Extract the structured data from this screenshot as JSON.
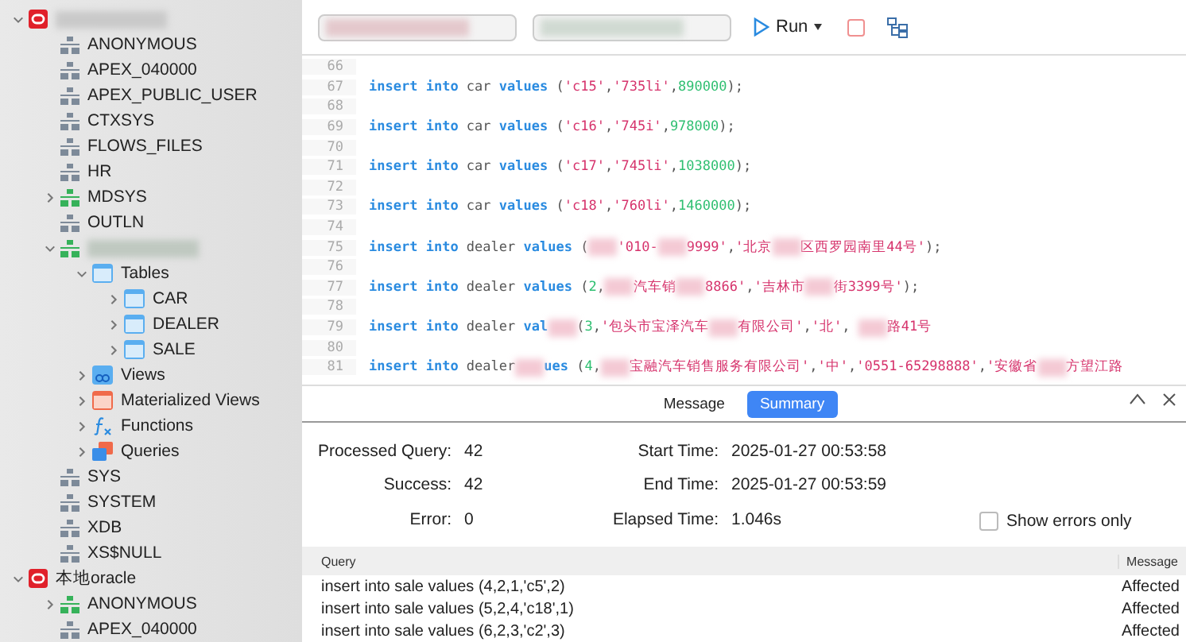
{
  "sidebar": {
    "tree": [
      {
        "kind": "connection",
        "redacted": true,
        "expanded": true,
        "children": [
          {
            "kind": "schema",
            "label": "ANONYMOUS",
            "open": false
          },
          {
            "kind": "schema",
            "label": "APEX_040000",
            "open": false
          },
          {
            "kind": "schema",
            "label": "APEX_PUBLIC_USER",
            "open": false
          },
          {
            "kind": "schema",
            "label": "CTXSYS",
            "open": false
          },
          {
            "kind": "schema",
            "label": "FLOWS_FILES",
            "open": false
          },
          {
            "kind": "schema",
            "label": "HR",
            "open": false
          },
          {
            "kind": "schema",
            "label": "MDSYS",
            "open": true,
            "expanded": false
          },
          {
            "kind": "schema",
            "label": "OUTLN",
            "open": false
          },
          {
            "kind": "schema",
            "redacted": true,
            "open": true,
            "expanded": true,
            "children": [
              {
                "kind": "tables",
                "label": "Tables",
                "expanded": true,
                "children": [
                  {
                    "kind": "table",
                    "label": "CAR",
                    "expanded": false
                  },
                  {
                    "kind": "table",
                    "label": "DEALER",
                    "expanded": false
                  },
                  {
                    "kind": "table",
                    "label": "SALE",
                    "expanded": false
                  }
                ]
              },
              {
                "kind": "views",
                "label": "Views",
                "expanded": false
              },
              {
                "kind": "matviews",
                "label": "Materialized Views",
                "expanded": false
              },
              {
                "kind": "functions",
                "label": "Functions",
                "expanded": false
              },
              {
                "kind": "queries",
                "label": "Queries",
                "expanded": false
              }
            ]
          },
          {
            "kind": "schema",
            "label": "SYS",
            "open": false
          },
          {
            "kind": "schema",
            "label": "SYSTEM",
            "open": false
          },
          {
            "kind": "schema",
            "label": "XDB",
            "open": false
          },
          {
            "kind": "schema",
            "label": "XS$NULL",
            "open": false
          }
        ]
      },
      {
        "kind": "connection",
        "label": "本地oracle",
        "expanded": true,
        "children": [
          {
            "kind": "schema",
            "label": "ANONYMOUS",
            "open": true,
            "expanded": false
          },
          {
            "kind": "schema",
            "label": "APEX_040000",
            "open": false
          }
        ]
      }
    ]
  },
  "toolbar": {
    "run_label": "Run"
  },
  "editor": {
    "lines": [
      {
        "number": "66"
      },
      {
        "number": "67",
        "tokens": [
          {
            "kind": "kw",
            "text": "insert"
          },
          {
            "kind": "kw",
            "text": " into"
          },
          {
            "kind": "id",
            "text": " car "
          },
          {
            "kind": "kw",
            "text": "values"
          },
          {
            "kind": "id",
            "text": " ("
          },
          {
            "kind": "str",
            "text": "'c15'"
          },
          {
            "kind": "id",
            "text": ","
          },
          {
            "kind": "str",
            "text": "'735li'"
          },
          {
            "kind": "id",
            "text": ","
          },
          {
            "kind": "num",
            "text": "890000"
          },
          {
            "kind": "id",
            "text": ");"
          }
        ]
      },
      {
        "number": "68"
      },
      {
        "number": "69",
        "tokens": [
          {
            "kind": "kw",
            "text": "insert"
          },
          {
            "kind": "kw",
            "text": " into"
          },
          {
            "kind": "id",
            "text": " car "
          },
          {
            "kind": "kw",
            "text": "values"
          },
          {
            "kind": "id",
            "text": " ("
          },
          {
            "kind": "str",
            "text": "'c16'"
          },
          {
            "kind": "id",
            "text": ","
          },
          {
            "kind": "str",
            "text": "'745i'"
          },
          {
            "kind": "id",
            "text": ","
          },
          {
            "kind": "num",
            "text": "978000"
          },
          {
            "kind": "id",
            "text": ");"
          }
        ]
      },
      {
        "number": "70"
      },
      {
        "number": "71",
        "tokens": [
          {
            "kind": "kw",
            "text": "insert"
          },
          {
            "kind": "kw",
            "text": " into"
          },
          {
            "kind": "id",
            "text": " car "
          },
          {
            "kind": "kw",
            "text": "values"
          },
          {
            "kind": "id",
            "text": " ("
          },
          {
            "kind": "str",
            "text": "'c17'"
          },
          {
            "kind": "id",
            "text": ","
          },
          {
            "kind": "str",
            "text": "'745li'"
          },
          {
            "kind": "id",
            "text": ","
          },
          {
            "kind": "num",
            "text": "1038000"
          },
          {
            "kind": "id",
            "text": ");"
          }
        ]
      },
      {
        "number": "72"
      },
      {
        "number": "73",
        "tokens": [
          {
            "kind": "kw",
            "text": "insert"
          },
          {
            "kind": "kw",
            "text": " into"
          },
          {
            "kind": "id",
            "text": " car "
          },
          {
            "kind": "kw",
            "text": "values"
          },
          {
            "kind": "id",
            "text": " ("
          },
          {
            "kind": "str",
            "text": "'c18'"
          },
          {
            "kind": "id",
            "text": ","
          },
          {
            "kind": "str",
            "text": "'760li'"
          },
          {
            "kind": "id",
            "text": ","
          },
          {
            "kind": "num",
            "text": "1460000"
          },
          {
            "kind": "id",
            "text": ");"
          }
        ]
      },
      {
        "number": "74"
      },
      {
        "number": "75",
        "tokens": [
          {
            "kind": "kw",
            "text": "insert"
          },
          {
            "kind": "kw",
            "text": " into"
          },
          {
            "kind": "id",
            "text": " dealer "
          },
          {
            "kind": "kw",
            "text": "values"
          },
          {
            "kind": "id",
            "text": " ("
          },
          {
            "kind": "redacted"
          },
          {
            "kind": "str",
            "text": "'010-"
          },
          {
            "kind": "redacted"
          },
          {
            "kind": "str",
            "text": "9999'"
          },
          {
            "kind": "id",
            "text": ","
          },
          {
            "kind": "str",
            "text": "'北京"
          },
          {
            "kind": "redacted"
          },
          {
            "kind": "str",
            "text": "区西罗园南里44号'"
          },
          {
            "kind": "id",
            "text": ");"
          }
        ]
      },
      {
        "number": "76"
      },
      {
        "number": "77",
        "tokens": [
          {
            "kind": "kw",
            "text": "insert"
          },
          {
            "kind": "kw",
            "text": " into"
          },
          {
            "kind": "id",
            "text": " dealer "
          },
          {
            "kind": "kw",
            "text": "values"
          },
          {
            "kind": "id",
            "text": " ("
          },
          {
            "kind": "num",
            "text": "2"
          },
          {
            "kind": "id",
            "text": ","
          },
          {
            "kind": "redacted"
          },
          {
            "kind": "str",
            "text": "汽车销"
          },
          {
            "kind": "redacted"
          },
          {
            "kind": "str",
            "text": "8866'"
          },
          {
            "kind": "id",
            "text": ","
          },
          {
            "kind": "str",
            "text": "'吉林市"
          },
          {
            "kind": "redacted"
          },
          {
            "kind": "str",
            "text": "街3399号'"
          },
          {
            "kind": "id",
            "text": ");"
          }
        ]
      },
      {
        "number": "78"
      },
      {
        "number": "79",
        "tokens": [
          {
            "kind": "kw",
            "text": "insert"
          },
          {
            "kind": "kw",
            "text": " into"
          },
          {
            "kind": "id",
            "text": " dealer "
          },
          {
            "kind": "kw",
            "text": "val"
          },
          {
            "kind": "redacted"
          },
          {
            "kind": "id",
            "text": "("
          },
          {
            "kind": "num",
            "text": "3"
          },
          {
            "kind": "id",
            "text": ","
          },
          {
            "kind": "str",
            "text": "'包头市宝泽汽车"
          },
          {
            "kind": "redacted"
          },
          {
            "kind": "str",
            "text": "有限公司'"
          },
          {
            "kind": "id",
            "text": ","
          },
          {
            "kind": "str",
            "text": "'北'"
          },
          {
            "kind": "id",
            "text": ", "
          },
          {
            "kind": "redacted"
          },
          {
            "kind": "str",
            "text": "路41号"
          }
        ]
      },
      {
        "number": "80"
      },
      {
        "number": "81",
        "tokens": [
          {
            "kind": "kw",
            "text": "insert"
          },
          {
            "kind": "kw",
            "text": " into"
          },
          {
            "kind": "id",
            "text": " dealer"
          },
          {
            "kind": "redacted"
          },
          {
            "kind": "kw",
            "text": "ues"
          },
          {
            "kind": "id",
            "text": " ("
          },
          {
            "kind": "num",
            "text": "4"
          },
          {
            "kind": "id",
            "text": ","
          },
          {
            "kind": "redacted"
          },
          {
            "kind": "str",
            "text": "宝融汽车销售服务有限公司'"
          },
          {
            "kind": "id",
            "text": ","
          },
          {
            "kind": "str",
            "text": "'中'"
          },
          {
            "kind": "id",
            "text": ","
          },
          {
            "kind": "str",
            "text": "'0551-65298888'"
          },
          {
            "kind": "id",
            "text": ","
          },
          {
            "kind": "str",
            "text": "'安徽省"
          },
          {
            "kind": "redacted"
          },
          {
            "kind": "str",
            "text": "方望江路"
          }
        ]
      }
    ]
  },
  "results": {
    "tabs": [
      {
        "label": "Message",
        "selected": false
      },
      {
        "label": "Summary",
        "selected": true
      }
    ],
    "stats": [
      {
        "label": "Processed Query:",
        "value": "42"
      },
      {
        "label": "Start Time:",
        "value": "2025-01-27 00:53:58"
      },
      {
        "label": "Success:",
        "value": "42"
      },
      {
        "label": "End Time:",
        "value": "2025-01-27 00:53:59"
      },
      {
        "label": "Error:",
        "value": "0"
      },
      {
        "label": "Elapsed Time:",
        "value": "1.046s"
      }
    ],
    "errors_only": {
      "label": "Show errors only",
      "checked": false
    },
    "table": {
      "columns": [
        "Query",
        "Message"
      ],
      "rows": [
        [
          "insert into sale values (4,2,1,'c5',2)",
          "Affected"
        ],
        [
          "insert into sale values (5,2,4,'c18',1)",
          "Affected"
        ],
        [
          "insert into sale values (6,2,3,'c2',3)",
          "Affected"
        ]
      ]
    }
  }
}
